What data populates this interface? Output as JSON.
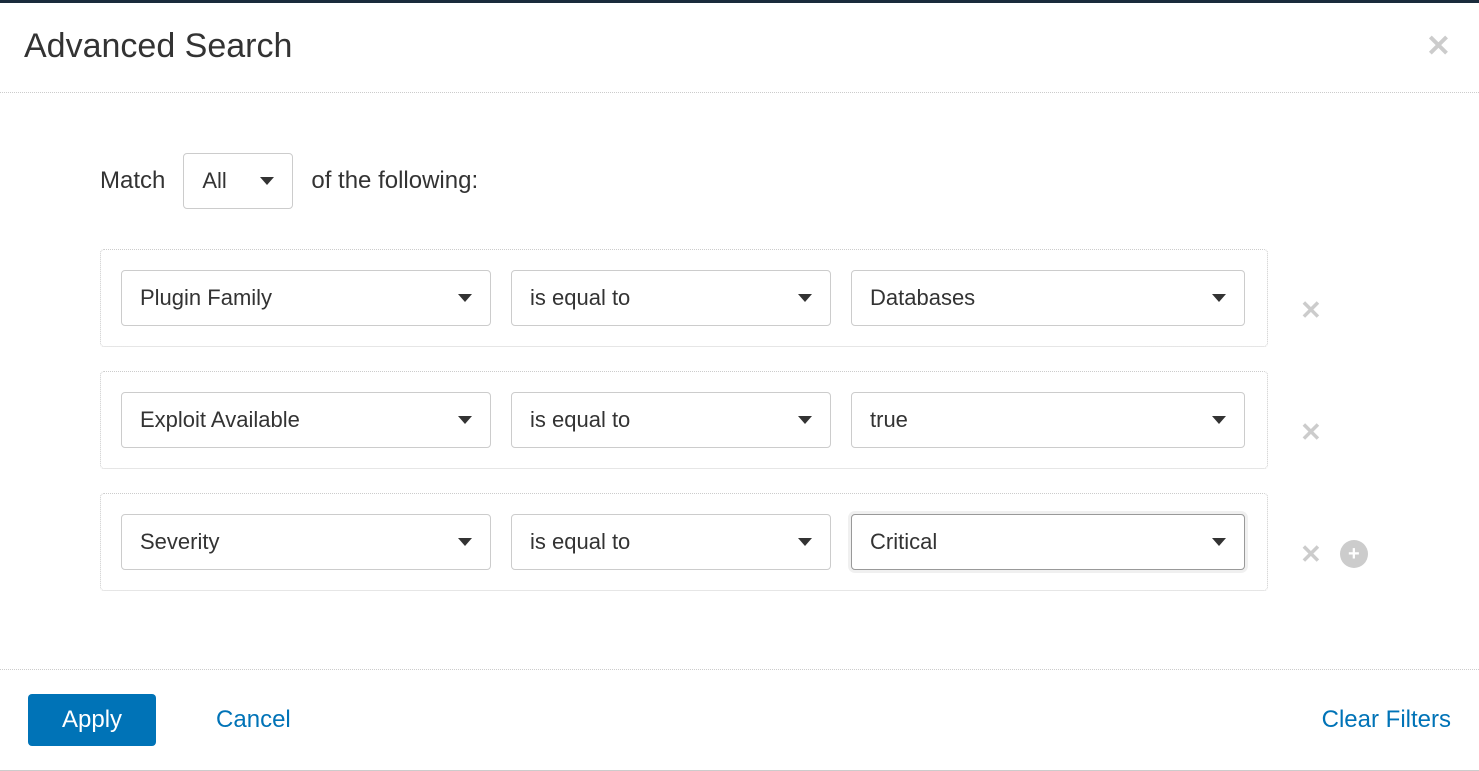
{
  "header": {
    "title": "Advanced Search"
  },
  "match": {
    "prefix": "Match",
    "selector": "All",
    "suffix": "of the following:"
  },
  "filters": [
    {
      "field": "Plugin Family",
      "operator": "is equal to",
      "value": "Databases"
    },
    {
      "field": "Exploit Available",
      "operator": "is equal to",
      "value": "true"
    },
    {
      "field": "Severity",
      "operator": "is equal to",
      "value": "Critical"
    }
  ],
  "footer": {
    "apply": "Apply",
    "cancel": "Cancel",
    "clear": "Clear Filters"
  }
}
